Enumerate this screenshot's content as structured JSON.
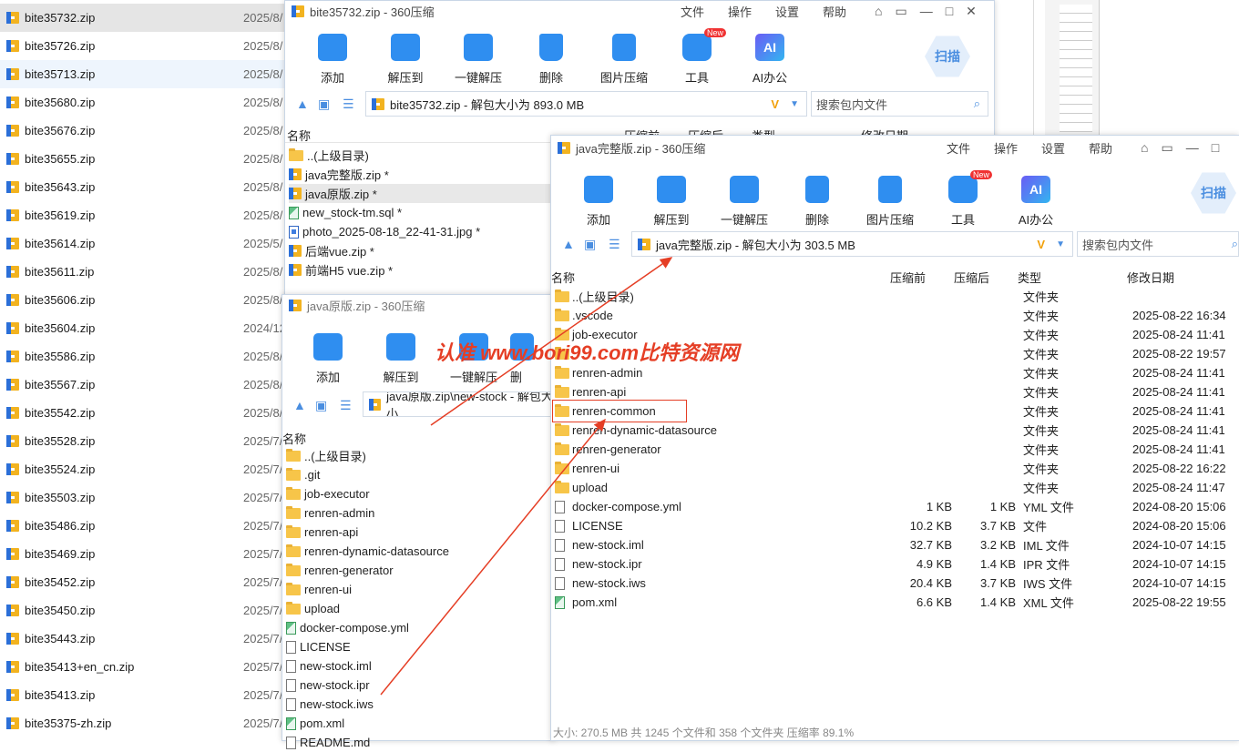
{
  "explorer": {
    "items": [
      {
        "name": "bite35732.zip",
        "date": "2025/8/"
      },
      {
        "name": "bite35726.zip",
        "date": "2025/8/"
      },
      {
        "name": "bite35713.zip",
        "date": "2025/8/"
      },
      {
        "name": "bite35680.zip",
        "date": "2025/8/"
      },
      {
        "name": "bite35676.zip",
        "date": "2025/8/"
      },
      {
        "name": "bite35655.zip",
        "date": "2025/8/"
      },
      {
        "name": "bite35643.zip",
        "date": "2025/8/"
      },
      {
        "name": "bite35619.zip",
        "date": "2025/8/"
      },
      {
        "name": "bite35614.zip",
        "date": "2025/5/"
      },
      {
        "name": "bite35611.zip",
        "date": "2025/8/"
      },
      {
        "name": "bite35606.zip",
        "date": "2025/8/"
      },
      {
        "name": "bite35604.zip",
        "date": "2024/12"
      },
      {
        "name": "bite35586.zip",
        "date": "2025/8/"
      },
      {
        "name": "bite35567.zip",
        "date": "2025/8/"
      },
      {
        "name": "bite35542.zip",
        "date": "2025/8/"
      },
      {
        "name": "bite35528.zip",
        "date": "2025/7/"
      },
      {
        "name": "bite35524.zip",
        "date": "2025/7/"
      },
      {
        "name": "bite35503.zip",
        "date": "2025/7/"
      },
      {
        "name": "bite35486.zip",
        "date": "2025/7/"
      },
      {
        "name": "bite35469.zip",
        "date": "2025/7/"
      },
      {
        "name": "bite35452.zip",
        "date": "2025/7/"
      },
      {
        "name": "bite35450.zip",
        "date": "2025/7/"
      },
      {
        "name": "bite35443.zip",
        "date": "2025/7/"
      },
      {
        "name": "bite35413+en_cn.zip",
        "date": "2025/7/"
      },
      {
        "name": "bite35413.zip",
        "date": "2025/7/"
      },
      {
        "name": "bite35375-zh.zip",
        "date": "2025/7/"
      }
    ]
  },
  "win1": {
    "title": "bite35732.zip - 360压缩",
    "menu": [
      "文件",
      "操作",
      "设置",
      "帮助"
    ],
    "tools": [
      "添加",
      "解压到",
      "一键解压",
      "删除",
      "图片压缩",
      "工具",
      "AI办公"
    ],
    "new_badge": "New",
    "scan": "扫描",
    "ai": "AI",
    "address": "bite35732.zip - 解包大小为 893.0 MB",
    "search_placeholder": "搜索包内文件",
    "col_name": "名称",
    "col_packed": "压缩前",
    "col_after": "压缩后",
    "col_type": "类型",
    "col_date": "修改日期",
    "rows": [
      "..(上级目录)",
      "java完整版.zip *",
      "java原版.zip *",
      "new_stock-tm.sql *",
      "photo_2025-08-18_22-41-31.jpg *",
      "后端vue.zip *",
      "前端H5 vue.zip *"
    ]
  },
  "win2": {
    "title": "java原版.zip - 360压缩",
    "tools": [
      "添加",
      "解压到",
      "一键解压",
      "删"
    ],
    "address": "java原版.zip\\new-stock - 解包大小",
    "col_name": "名称",
    "rows": [
      "..(上级目录)",
      ".git",
      "job-executor",
      "renren-admin",
      "renren-api",
      "renren-dynamic-datasource",
      "renren-generator",
      "renren-ui",
      "upload",
      "docker-compose.yml",
      "LICENSE",
      "new-stock.iml",
      "new-stock.ipr",
      "new-stock.iws",
      "pom.xml",
      "README.md"
    ]
  },
  "win3": {
    "title": "java完整版.zip - 360压缩",
    "menu": [
      "文件",
      "操作",
      "设置",
      "帮助"
    ],
    "tools": [
      "添加",
      "解压到",
      "一键解压",
      "删除",
      "图片压缩",
      "工具",
      "AI办公"
    ],
    "new_badge": "New",
    "scan": "扫描",
    "ai": "AI",
    "address": "java完整版.zip - 解包大小为 303.5 MB",
    "search_placeholder": "搜索包内文件",
    "columns": {
      "name": "名称",
      "before": "压缩前",
      "after": "压缩后",
      "type": "类型",
      "date": "修改日期"
    },
    "rows": [
      {
        "name": "..(上级目录)",
        "before": "",
        "after": "",
        "type": "文件夹",
        "date": "",
        "icon": "folder"
      },
      {
        "name": ".vscode",
        "before": "",
        "after": "",
        "type": "文件夹",
        "date": "2025-08-22 16:34",
        "icon": "folder"
      },
      {
        "name": "job-executor",
        "before": "",
        "after": "",
        "type": "文件夹",
        "date": "2025-08-24 11:41",
        "icon": "folder"
      },
      {
        "name": "",
        "before": "",
        "after": "",
        "type": "文件夹",
        "date": "2025-08-22 19:57",
        "icon": "folder"
      },
      {
        "name": "renren-admin",
        "before": "",
        "after": "",
        "type": "文件夹",
        "date": "2025-08-24 11:41",
        "icon": "folder"
      },
      {
        "name": "renren-api",
        "before": "",
        "after": "",
        "type": "文件夹",
        "date": "2025-08-24 11:41",
        "icon": "folder"
      },
      {
        "name": "renren-common",
        "before": "",
        "after": "",
        "type": "文件夹",
        "date": "2025-08-24 11:41",
        "icon": "folder"
      },
      {
        "name": "renren-dynamic-datasource",
        "before": "",
        "after": "",
        "type": "文件夹",
        "date": "2025-08-24 11:41",
        "icon": "folder"
      },
      {
        "name": "renren-generator",
        "before": "",
        "after": "",
        "type": "文件夹",
        "date": "2025-08-24 11:41",
        "icon": "folder"
      },
      {
        "name": "renren-ui",
        "before": "",
        "after": "",
        "type": "文件夹",
        "date": "2025-08-22 16:22",
        "icon": "folder"
      },
      {
        "name": "upload",
        "before": "",
        "after": "",
        "type": "文件夹",
        "date": "2025-08-24 11:47",
        "icon": "folder"
      },
      {
        "name": "docker-compose.yml",
        "before": "1 KB",
        "after": "1 KB",
        "type": "YML 文件",
        "date": "2024-08-20 15:06",
        "icon": "file"
      },
      {
        "name": "LICENSE",
        "before": "10.2 KB",
        "after": "3.7 KB",
        "type": "文件",
        "date": "2024-08-20 15:06",
        "icon": "file"
      },
      {
        "name": "new-stock.iml",
        "before": "32.7 KB",
        "after": "3.2 KB",
        "type": "IML 文件",
        "date": "2024-10-07 14:15",
        "icon": "file"
      },
      {
        "name": "new-stock.ipr",
        "before": "4.9 KB",
        "after": "1.4 KB",
        "type": "IPR 文件",
        "date": "2024-10-07 14:15",
        "icon": "file"
      },
      {
        "name": "new-stock.iws",
        "before": "20.4 KB",
        "after": "3.7 KB",
        "type": "IWS 文件",
        "date": "2024-10-07 14:15",
        "icon": "file"
      },
      {
        "name": "pom.xml",
        "before": "6.6 KB",
        "after": "1.4 KB",
        "type": "XML 文件",
        "date": "2025-08-22 19:55",
        "icon": "green"
      }
    ],
    "status": "大小: 270.5 MB 共 1245 个文件和 358 个文件夹 压缩率 89.1%"
  },
  "watermark": "认准 www.bori99.com比特资源网",
  "colors": {
    "accent": "#2f8ef0",
    "annotation": "#e53e25",
    "selected": "#e5e5e5"
  }
}
